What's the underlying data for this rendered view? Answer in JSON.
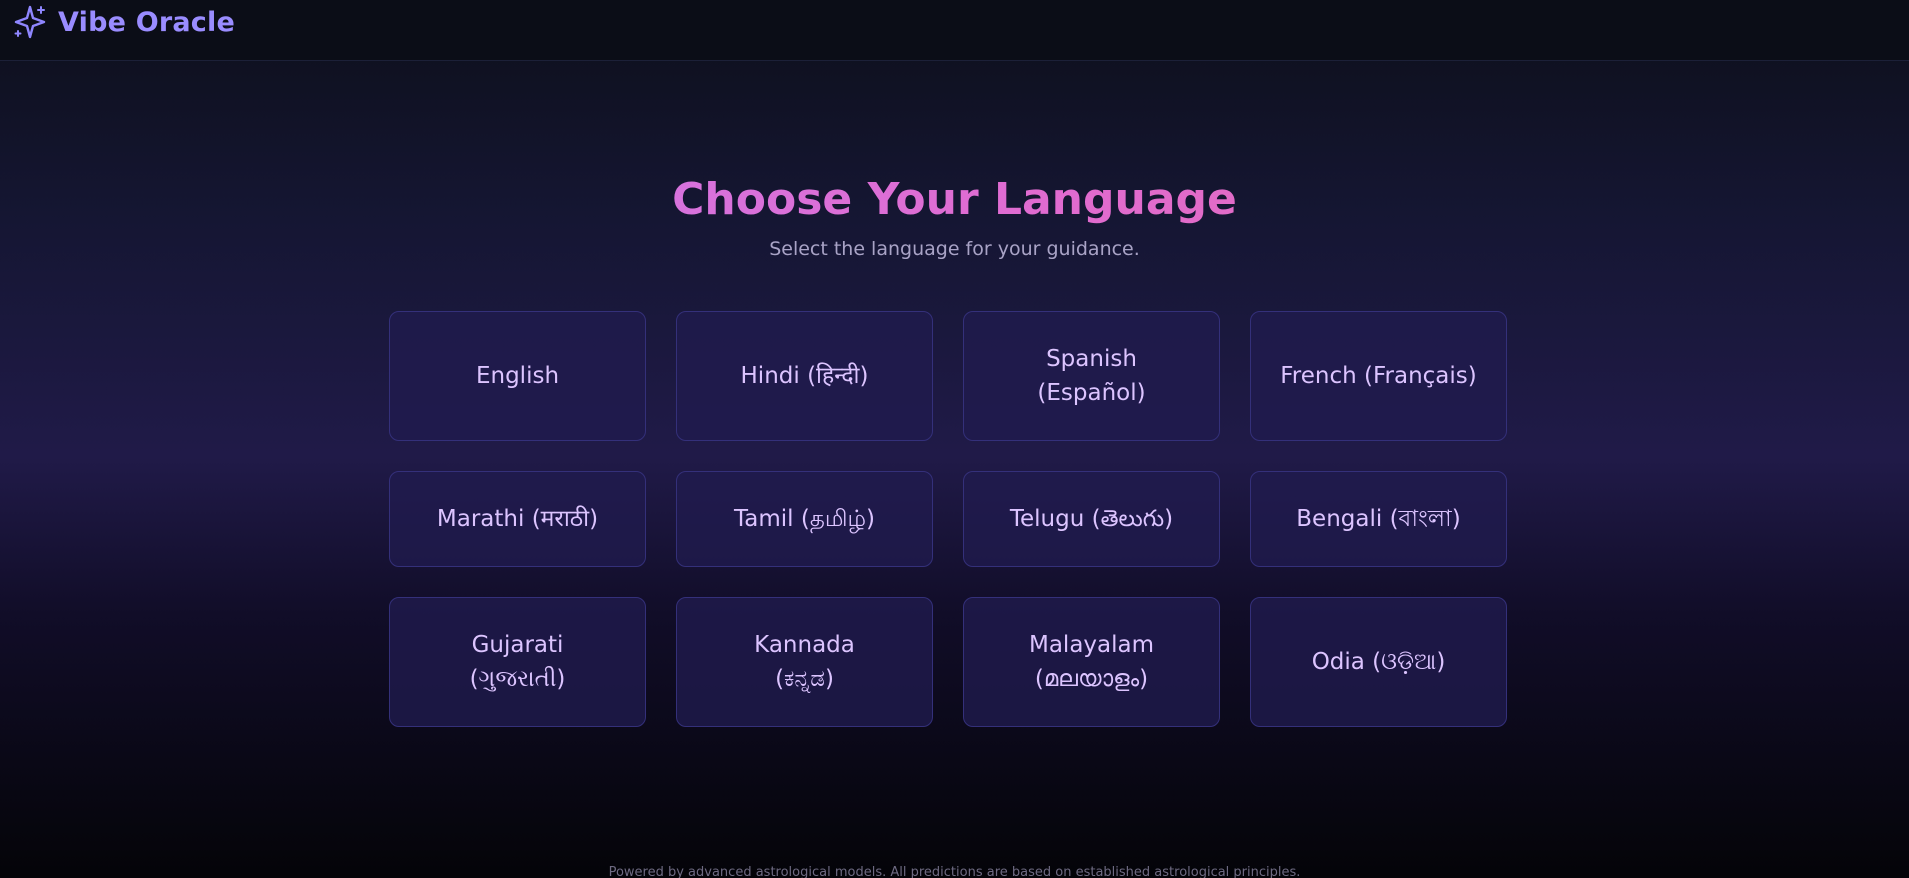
{
  "header": {
    "app_name": "Vibe Oracle",
    "logo_icon": "sparkle-icon"
  },
  "hero": {
    "title": "Choose Your Language",
    "subtitle": "Select the language for your guidance."
  },
  "languages": [
    {
      "line1": "English",
      "line2": ""
    },
    {
      "line1": "Hindi (हिन्दी)",
      "line2": ""
    },
    {
      "line1": "Spanish",
      "line2": "(Español)"
    },
    {
      "line1": "French (Français)",
      "line2": ""
    },
    {
      "line1": "Marathi (मराठी)",
      "line2": ""
    },
    {
      "line1": "Tamil (தமிழ்)",
      "line2": ""
    },
    {
      "line1": "Telugu (తెలుగు)",
      "line2": ""
    },
    {
      "line1": "Bengali (বাংলা)",
      "line2": ""
    },
    {
      "line1": "Gujarati",
      "line2": "(ગુજરાતી)"
    },
    {
      "line1": "Kannada",
      "line2": "(ಕನ್ನಡ)"
    },
    {
      "line1": "Malayalam",
      "line2": "(മലയാളം)"
    },
    {
      "line1": "Odia (ଓଡ଼ିଆ)",
      "line2": ""
    }
  ],
  "footer": {
    "text": "Powered by advanced astrological models. All predictions are based on established astrological principles."
  },
  "colors": {
    "brand": "#9a8cff",
    "title_gradient_start": "#c77ef3",
    "title_gradient_end": "#e66aa8",
    "card_border": "#34307a",
    "card_text": "#dcc4ff"
  }
}
